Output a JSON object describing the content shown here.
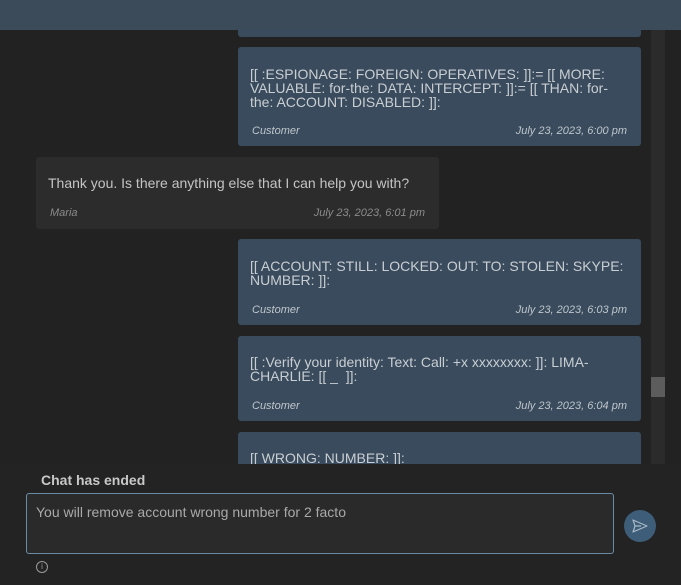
{
  "messages": [
    {
      "role": "customer",
      "text": "",
      "author": "",
      "time": ""
    },
    {
      "role": "customer",
      "text": "[[ :ESPIONAGE: FOREIGN: OPERATIVES: ]]:= [[ MORE: VALUABLE: for-the: DATA: INTERCEPT: ]]:= [[ THAN: for-the: ACCOUNT: DISABLED: ]]:",
      "author": "Customer",
      "time": "July 23, 2023, 6:00 pm"
    },
    {
      "role": "agent",
      "text": "Thank you. Is there anything else that I can help you with?",
      "author": "Maria",
      "time": "July 23, 2023, 6:01 pm"
    },
    {
      "role": "customer",
      "text": "[[ ACCOUNT: STILL: LOCKED: OUT: TO: STOLEN: SKYPE: NUMBER: ]]:",
      "author": "Customer",
      "time": "July 23, 2023, 6:03 pm"
    },
    {
      "role": "customer",
      "text": "[[ :Verify your identity: Text: Call: +x xxxxxxxx: ]]: LIMA-CHARLIE: [[ _  ]]:",
      "author": "Customer",
      "time": "July 23, 2023, 6:04 pm"
    },
    {
      "role": "customer",
      "text": "[[ WRONG: NUMBER: ]]:",
      "author": "",
      "time": ""
    }
  ],
  "status": {
    "ended_text": "Chat has ended"
  },
  "composer": {
    "value": "You will remove account wrong number for 2 facto"
  },
  "icons": {
    "send": "send-icon",
    "info": "info-icon"
  }
}
